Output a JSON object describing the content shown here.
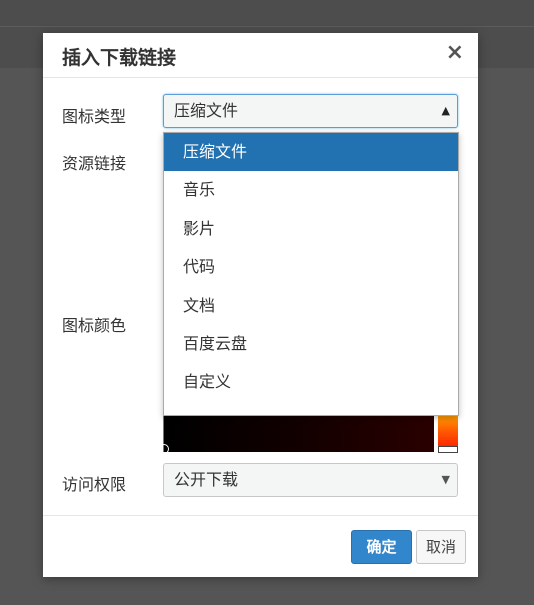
{
  "dialog": {
    "title": "插入下载链接",
    "close_symbol": "×"
  },
  "form": {
    "icon_type": {
      "label": "图标类型",
      "value": "压缩文件",
      "options": [
        "压缩文件",
        "音乐",
        "影片",
        "代码",
        "文档",
        "百度云盘",
        "自定义"
      ],
      "selected_index": 0
    },
    "resource_link": {
      "label": "资源链接"
    },
    "icon_color": {
      "label": "图标颜色"
    },
    "access": {
      "label": "访问权限",
      "value": "公开下载"
    }
  },
  "footer": {
    "confirm_label": "确定",
    "cancel_label": "取消"
  },
  "colors": {
    "accent": "#2271b1",
    "confirm_button": "#3186cc",
    "overlay": "#4d4d4d"
  },
  "icons": [
    "close-icon",
    "caret-up-icon",
    "caret-down-icon"
  ]
}
